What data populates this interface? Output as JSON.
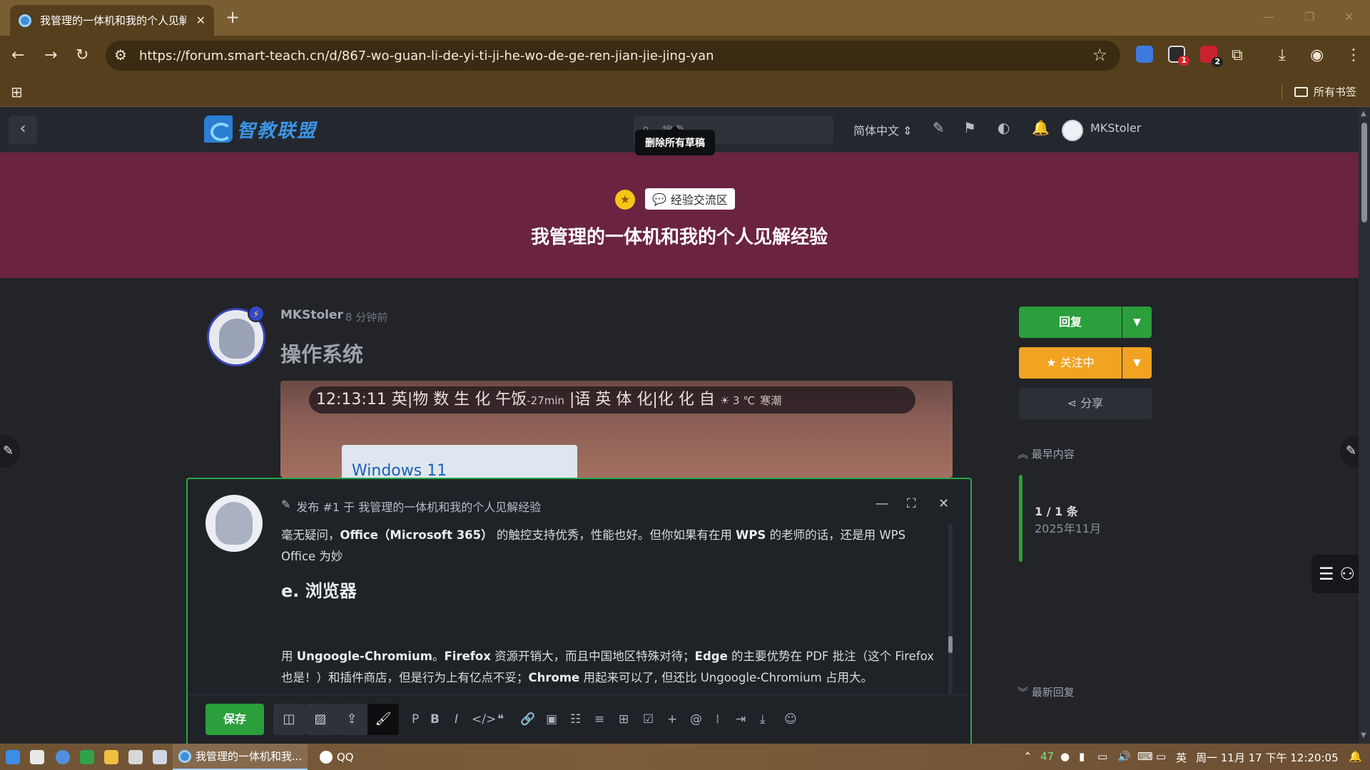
{
  "browser": {
    "tab_title": "我管理的一体机和我的个人见解",
    "url": "https://forum.smart-teach.cn/d/867-wo-guan-li-de-yi-ti-ji-he-wo-de-ge-ren-jian-jie-jing-yan",
    "extension_badges": [
      "1",
      "2"
    ],
    "bookmark_folder": "所有书签"
  },
  "forum": {
    "logo_text": "智教联盟",
    "search_placeholder": "搜索",
    "tooltip": "删除所有草稿",
    "language": "简体中文",
    "username": "MKStoler"
  },
  "discussion": {
    "tag": "经验交流区",
    "title": "我管理的一体机和我的个人见解经验"
  },
  "post": {
    "author": "MKStoler",
    "time": "8 分钟前",
    "heading": "操作系统",
    "image": {
      "clock": "12:13:11",
      "schedule": "英|物 数 生 化",
      "current": "午饭",
      "countdown": "-27min",
      "next": "|语 英 体 化|化 化 自",
      "weather": "☀ 3 ℃",
      "weather_extra": "寒潮",
      "window_text": "Windows 11"
    }
  },
  "sidebar": {
    "reply": "回复",
    "follow": "关注中",
    "share": "分享",
    "earliest": "最早内容",
    "count": "1 / 1 条",
    "date": "2025年11月",
    "latest": "最新回复"
  },
  "composer": {
    "header": "发布 #1 于 我管理的一体机和我的个人见解经验",
    "p1_a": "毫无疑问，",
    "p1_b": "Office（Microsoft 365）",
    "p1_c": " 的触控支持优秀，性能也好。但你如果有在用 ",
    "p1_d": "WPS",
    "p1_e": " 的老师的话，还是用 WPS Office 为妙",
    "h2": "e. 浏览器",
    "p2_a": "用 ",
    "p2_b": "Ungoogle-Chromium",
    "p2_c": "。",
    "p2_d": "Firefox",
    "p2_e": " 资源开销大，而且中国地区特殊对待；",
    "p2_f": "Edge",
    "p2_g": " 的主要优势在 PDF 批注（这个 Firefox 也是！）和插件商店，但是行为上有亿点不妥；",
    "p2_h": "Chrome",
    "p2_i": " 用起来可以了, 但还比 Ungoogle-Chromium 占用大。",
    "save": "保存"
  },
  "taskbar": {
    "active_task": "我管理的一体机和我...",
    "qq_task": "QQ",
    "temp": "47",
    "ime": "英",
    "datetime": "周一 11月 17  下午 12:20:05"
  },
  "colors": {
    "hero": "#6a2340",
    "accent_green": "#2a9f3b",
    "follow_orange": "#f2a322",
    "browser_frame": "#553f1c"
  }
}
